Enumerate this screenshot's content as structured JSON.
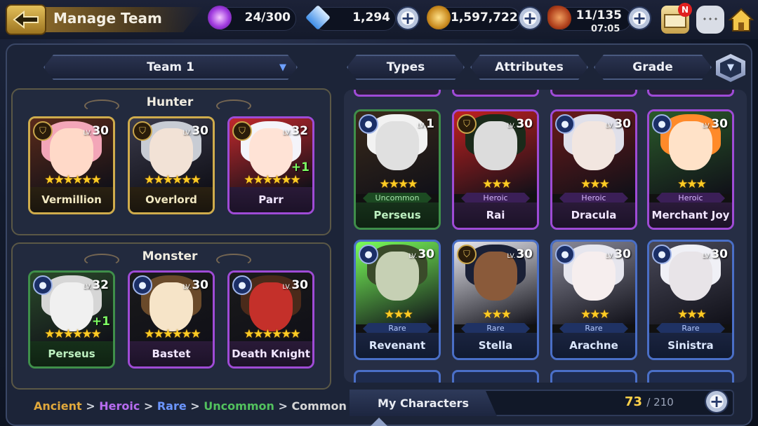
{
  "header": {
    "title": "Manage Team",
    "back_icon": "back-arrow-icon",
    "resources": [
      {
        "name": "stamina-potion",
        "icon": "potion-icon",
        "value": "24/300"
      },
      {
        "name": "crystal",
        "icon": "crystal-icon",
        "value": "1,294"
      },
      {
        "name": "gold",
        "icon": "gold-coin-icon",
        "value": "1,597,722"
      },
      {
        "name": "meat",
        "icon": "meat-icon",
        "value": "11/135"
      }
    ],
    "timer": "07:05",
    "mail_badge": "N",
    "icons": [
      "mail-icon",
      "chat-icon",
      "home-icon"
    ]
  },
  "team_selector": {
    "label": "Team 1"
  },
  "filters": [
    {
      "label": "Types"
    },
    {
      "label": "Attributes"
    },
    {
      "label": "Grade"
    }
  ],
  "groups": [
    {
      "title": "Hunter",
      "members": [
        {
          "name": "Vermillion",
          "level": "30",
          "stars": "★★★★★★",
          "grade": "ancient",
          "type_icon": "shield-icon",
          "bonus": ""
        },
        {
          "name": "Overlord",
          "level": "30",
          "stars": "★★★★★★",
          "grade": "ancient",
          "type_icon": "shield-icon",
          "bonus": ""
        },
        {
          "name": "Parr",
          "level": "32",
          "stars": "★★★★★★",
          "grade": "heroic",
          "type_icon": "shield-icon",
          "bonus": "+1"
        }
      ]
    },
    {
      "title": "Monster",
      "members": [
        {
          "name": "Perseus",
          "level": "32",
          "stars": "★★★★★★",
          "grade": "uncommon",
          "type_icon": "orb-icon",
          "bonus": "+1"
        },
        {
          "name": "Bastet",
          "level": "30",
          "stars": "★★★★★★",
          "grade": "heroic",
          "type_icon": "orb-icon",
          "bonus": ""
        },
        {
          "name": "Death Knight",
          "level": "30",
          "stars": "★★★★★★",
          "grade": "heroic",
          "type_icon": "orb-icon",
          "bonus": ""
        }
      ]
    }
  ],
  "characters": [
    {
      "name": "Perseus",
      "level": "1",
      "stars": "★★★★",
      "grade": "uncommon",
      "grade_label": "Uncommon",
      "type_icon": "orb-icon"
    },
    {
      "name": "Rai",
      "level": "30",
      "stars": "★★★",
      "grade": "heroic",
      "grade_label": "Heroic",
      "type_icon": "shield-icon"
    },
    {
      "name": "Dracula",
      "level": "30",
      "stars": "★★★",
      "grade": "heroic",
      "grade_label": "Heroic",
      "type_icon": "orb-icon"
    },
    {
      "name": "Merchant Joy",
      "level": "30",
      "stars": "★★★",
      "grade": "heroic",
      "grade_label": "Heroic",
      "type_icon": "orb-icon"
    },
    {
      "name": "Revenant",
      "level": "30",
      "stars": "★★★",
      "grade": "rare",
      "grade_label": "Rare",
      "type_icon": "orb-icon"
    },
    {
      "name": "Stella",
      "level": "30",
      "stars": "★★★",
      "grade": "rare",
      "grade_label": "Rare",
      "type_icon": "shield-icon"
    },
    {
      "name": "Arachne",
      "level": "30",
      "stars": "★★★",
      "grade": "rare",
      "grade_label": "Rare",
      "type_icon": "orb-icon"
    },
    {
      "name": "Sinistra",
      "level": "30",
      "stars": "★★★",
      "grade": "rare",
      "grade_label": "Rare",
      "type_icon": "orb-icon"
    }
  ],
  "legend": [
    {
      "label": "Ancient",
      "color": "#e0a83c"
    },
    {
      "label": "Heroic",
      "color": "#b76cf0"
    },
    {
      "label": "Rare",
      "color": "#6b95ff"
    },
    {
      "label": "Uncommon",
      "color": "#52c15e"
    },
    {
      "label": "Common",
      "color": "#d6d6d6"
    }
  ],
  "legend_separator": ">",
  "footer": {
    "my_characters_label": "My Characters",
    "owned": "73",
    "capacity": "/ 210"
  }
}
